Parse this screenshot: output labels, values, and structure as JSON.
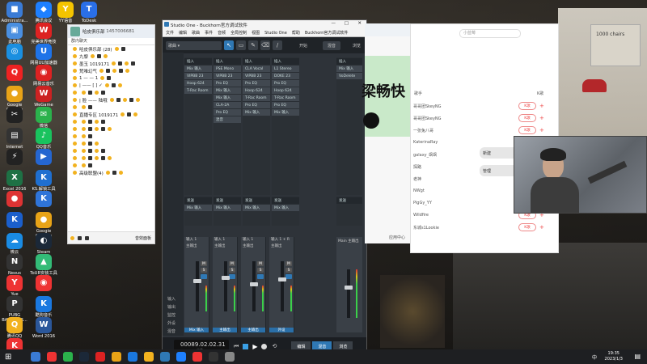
{
  "desktop": {
    "icons": [
      {
        "label": "Administra...",
        "color": "#3a7bd5",
        "glyph": "■"
      },
      {
        "label": "腾讯会议",
        "color": "#1e80ff",
        "glyph": "◆"
      },
      {
        "label": "YY语音",
        "color": "#f5c400",
        "glyph": "Y"
      },
      {
        "label": "ToDesk",
        "color": "#2a6fe8",
        "glyph": "T"
      },
      {
        "label": "此电脑",
        "color": "#4a8fe0",
        "glyph": "▣"
      },
      {
        "label": "完美世界竞技平台",
        "color": "#d22",
        "glyph": "W"
      },
      {
        "label": "",
        "color": "#1a8fe0",
        "glyph": "◎"
      },
      {
        "label": "网易UU加速器",
        "color": "#1e73e8",
        "glyph": "U"
      },
      {
        "label": "",
        "color": "#e22",
        "glyph": "Q"
      },
      {
        "label": "网易云音乐",
        "color": "#d22",
        "glyph": "◉"
      },
      {
        "label": "Google Chrome",
        "color": "#e8a317",
        "glyph": "●"
      },
      {
        "label": "WeGame",
        "color": "#c22",
        "glyph": "W"
      },
      {
        "label": "",
        "color": "#222",
        "glyph": "✂"
      },
      {
        "label": "微信",
        "color": "#2bb24c",
        "glyph": "✉"
      },
      {
        "label": "Internet",
        "color": "#333",
        "glyph": "▤"
      },
      {
        "label": "QQ音乐",
        "color": "#19c35e",
        "glyph": "♪"
      },
      {
        "label": "",
        "color": "#222",
        "glyph": "⚡"
      },
      {
        "label": "",
        "color": "#2566d0",
        "glyph": "▶"
      },
      {
        "label": "Excel 2016",
        "color": "#1e7145",
        "glyph": "X"
      },
      {
        "label": "KS.解锁工具",
        "color": "#1f6fd0",
        "glyph": "K"
      },
      {
        "label": "",
        "color": "#d33",
        "glyph": "●"
      },
      {
        "label": "",
        "color": "#2f74d8",
        "glyph": "K"
      },
      {
        "label": "",
        "color": "#1b5fcc",
        "glyph": "K"
      },
      {
        "label": "Google Chrome",
        "color": "#e8a317",
        "glyph": "●"
      },
      {
        "label": "微云",
        "color": "#1a8be3",
        "glyph": "☁"
      },
      {
        "label": "Steam",
        "color": "#1b2838",
        "glyph": "◐"
      },
      {
        "label": "Nexus",
        "color": "#333",
        "glyph": "N"
      },
      {
        "label": "ToUR安装工具3.0.1",
        "color": "#3b7",
        "glyph": "▲"
      },
      {
        "label": "Yue",
        "color": "#e33",
        "glyph": "Y"
      },
      {
        "label": "",
        "color": "#e33",
        "glyph": "◉"
      },
      {
        "label": "PUBG BATTLEGR...",
        "color": "#333",
        "glyph": "P"
      },
      {
        "label": "酷狗音乐",
        "color": "#1a78e0",
        "glyph": "K"
      },
      {
        "label": "腾讯QQ",
        "color": "#f2b21f",
        "glyph": "Q"
      },
      {
        "label": "Word 2016",
        "color": "#2b579a",
        "glyph": "W"
      },
      {
        "label": "全民K歌",
        "color": "#e33",
        "glyph": "K"
      }
    ],
    "poster_text": "1000 chairs"
  },
  "chat": {
    "title": "哈皮俱乐部",
    "id": "1457006681",
    "tab": "群内聊天",
    "rows": [
      "哈皮俱乐部 (28)",
      "九黎",
      "墨玉 1019171",
      "梵唯幻气",
      "1 — — 1",
      "| —— [   ] ✓",
      "",
      "| 脸 —— 陆哦",
      "",
      "直播专区 1019171",
      "",
      "",
      "",
      "",
      "",
      "",
      "",
      "高级联盟(4)"
    ],
    "input_button": "音效面板"
  },
  "studio_one": {
    "title": "Studio One - Buckhorn官方调试软件",
    "menu": [
      "文件",
      "编辑",
      "歌曲",
      "事件",
      "音频",
      "全局控制",
      "视图",
      "Studio One",
      "帮助",
      "Buckhorn官方调试软件"
    ],
    "toolbar_tab1": "开始",
    "toolbar_tab2": "混音",
    "toolbar_tab3": "浏览",
    "tracks_col1": [
      "Mix 输入",
      "VIPBB 23",
      "Hoop 624",
      "T-Rac Room"
    ],
    "tracks_col2": [
      "PSE Mono",
      "VIPBB 23",
      "Pro EQ",
      "Mix 输入",
      "Mix 输入",
      "CLA-2A",
      "Pro EQ",
      "混音"
    ],
    "tracks_col3": [
      "CLA Vocal",
      "VIPBB 23",
      "Pro EQ",
      "Hoop 624",
      "T-Rac Room",
      "Pro EQ",
      "Mix 输入"
    ],
    "tracks_col4": [
      "L1 Stereo",
      "DOKE 23",
      "Pro EQ",
      "Hoop 624",
      "T-Rac Room",
      "Pro EQ",
      "Mix 输入"
    ],
    "aux_col": [
      "Mix 输入",
      "VoDelete"
    ],
    "section_labels": [
      "发送",
      "发送",
      "发送",
      "发送",
      "发送"
    ],
    "channels": [
      {
        "input": "输入 1",
        "out": "主输出",
        "name": "Mix 输入"
      },
      {
        "input": "输入 1",
        "out": "主输出",
        "name": "主输出"
      },
      {
        "input": "输入 1",
        "out": "主输出",
        "name": "主输出"
      },
      {
        "input": "输入 1 + R",
        "out": "主输出",
        "name": "外设"
      }
    ],
    "master_label": "Main 主输出",
    "left_labels": [
      "输入",
      "输出",
      "监控",
      "外设",
      "混音"
    ],
    "timecode": "00089.02.02.31",
    "timecode_sub": "小节",
    "bottom_tabs": [
      "编辑",
      "混音",
      "浏览"
    ],
    "tracks_header": [
      "插入",
      "插入",
      "插入",
      "插入",
      "插入"
    ]
  },
  "kugou": {
    "headline": "梁畅快",
    "footer": "应用中心"
  },
  "songlist": {
    "search_placeholder": "小蓝莓",
    "col_song": "歌手",
    "col_k": "K歌",
    "rows": [
      "哥哥团SkeyNG",
      "哥哥团SkeyNG",
      "一张兔八哥",
      "KaterinaRay",
      "galaxy_飒飒",
      "探路",
      "老神",
      "NWgt",
      "PigGy_YY",
      "Wildfire",
      "东城s1Lookie"
    ],
    "k_label": "K歌",
    "bubbles": [
      "新建",
      "管理"
    ]
  },
  "taskbar": {
    "time": "19:35",
    "date": "2023/1/3",
    "lang": "中"
  }
}
